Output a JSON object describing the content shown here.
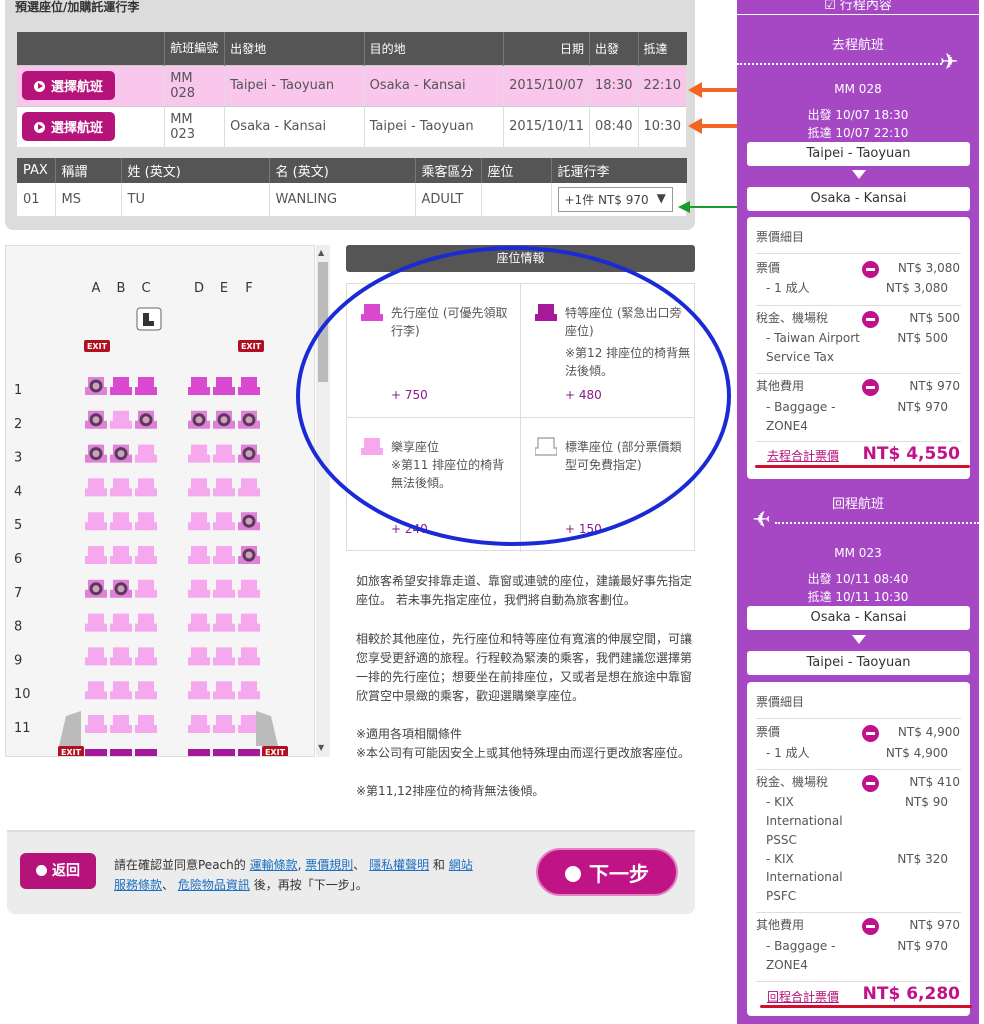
{
  "section_title": "預選座位/加購託運行李",
  "flights": {
    "headers": [
      "",
      "航班編號",
      "出發地",
      "目的地",
      "日期",
      "出發",
      "抵達"
    ],
    "select_label": "選擇航班",
    "rows": [
      {
        "flight": "MM 028",
        "from": "Taipei - Taoyuan",
        "to": "Osaka - Kansai",
        "date": "2015/10/07",
        "dep": "18:30",
        "arr": "22:10"
      },
      {
        "flight": "MM 023",
        "from": "Osaka - Kansai",
        "to": "Taipei - Taoyuan",
        "date": "2015/10/11",
        "dep": "08:40",
        "arr": "10:30"
      }
    ]
  },
  "pax": {
    "headers": [
      "PAX",
      "稱謂",
      "姓 (英文)",
      "名 (英文)",
      "乘客區分",
      "座位",
      "託運行李"
    ],
    "row": {
      "pax": "01",
      "title": "MS",
      "last": "TU",
      "first": "WANLING",
      "type": "ADULT",
      "seat": "",
      "bag": "+1件 NT$ 970"
    }
  },
  "seatmap": {
    "columns": [
      "A",
      "B",
      "C",
      "D",
      "E",
      "F"
    ],
    "rows": [
      "1",
      "2",
      "3",
      "4",
      "5",
      "6",
      "7",
      "8",
      "9",
      "10",
      "11"
    ],
    "exit": "EXIT"
  },
  "seat_info": {
    "title": "座位情報",
    "items": [
      {
        "name": "先行座位 (可優先領取行李)",
        "price": "+ 750"
      },
      {
        "name": "特等座位 (緊急出口旁座位)",
        "note": "※第12 排座位的椅背無法後傾。",
        "price": "+ 480"
      },
      {
        "name": "樂享座位",
        "note": "※第11 排座位的椅背無法後傾。",
        "price": "+ 240"
      },
      {
        "name": "標準座位 (部分票價類型可免費指定)",
        "price": "+ 150"
      }
    ],
    "para1": "如旅客希望安排靠走道、靠窗或連號的座位，建議最好事先指定座位。 若未事先指定座位，我們將自動為旅客劃位。",
    "para2": "相較於其他座位，先行座位和特等座位有寬濱的伸展空間，可讓您享受更舒適的旅程。行程較為緊湊的乘客，我們建議您選擇第一排的先行座位；想要坐在前排座位，又或者是想在旅途中靠窗欣賞空中景緻的乘客，歡迎選購樂享座位。",
    "notes": [
      "※適用各項相關條件",
      "※本公司有可能因安全上或其他特殊理由而逕行更改旅客座位。",
      "※第11,12排座位的椅背無法後傾。"
    ]
  },
  "footer": {
    "back": "返回",
    "next": "下一步",
    "text1": "請在確認並同意Peach的",
    "link1": "運輸條款",
    "link2": "票價規則",
    "link3": "隱私權聲明",
    "and": "和",
    "link4a": "網站",
    "link4b": "服務條款",
    "link5": "危險物品資訊",
    "text2": "後，再按「下一步」。"
  },
  "sidebar": {
    "title": "行程內容",
    "outbound": {
      "label": "去程航班",
      "flight": "MM 028",
      "dep": "出發 10/07 18:30",
      "arr": "抵達 10/07 22:10",
      "from": "Taipei - Taoyuan",
      "to": "Osaka - Kansai",
      "detail_title": "票價細目",
      "fare_label": "票價",
      "fare_val": "NT$ 3,080",
      "fare_sub": "- 1  成人",
      "fare_sub_val": "NT$ 3,080",
      "tax_label": "稅金、機場稅",
      "tax_val": "NT$ 500",
      "tax_sub1": "- Taiwan Airport",
      "tax_sub2": "Service Tax",
      "tax_sub_val": "NT$ 500",
      "other_label": "其他費用",
      "other_val": "NT$ 970",
      "other_sub1": "- Baggage -",
      "other_sub2": "ZONE4",
      "other_sub_val": "NT$ 970",
      "total_label": "去程合計票價",
      "total_val": "NT$ 4,550"
    },
    "inbound": {
      "label": "回程航班",
      "flight": "MM  023",
      "dep": "出發 10/11 08:40",
      "arr": "抵達 10/11 10:30",
      "from": "Osaka - Kansai",
      "to": "Taipei - Taoyuan",
      "detail_title": "票價細目",
      "fare_label": "票價",
      "fare_val": "NT$ 4,900",
      "fare_sub": "- 1  成人",
      "fare_sub_val": "NT$ 4,900",
      "tax_label": "稅金、機場稅",
      "tax_val": "NT$ 410",
      "tax_a1": "- KIX",
      "tax_a2": "International",
      "tax_a3": "PSSC",
      "tax_a_val": "NT$ 90",
      "tax_b1": "- KIX",
      "tax_b2": "International",
      "tax_b3": "PSFC",
      "tax_b_val": "NT$ 320",
      "other_label": "其他費用",
      "other_val": "NT$ 970",
      "other_sub1": "- Baggage -",
      "other_sub2": "ZONE4",
      "other_sub_val": "NT$ 970",
      "total_label": "回程合計票價",
      "total_val": "NT$ 6,280"
    }
  },
  "colors": {
    "brand": "#b5127a",
    "sidebar": "#a648c4",
    "annotation_blue": "#1a2ad4",
    "annotation_orange": "#f26522",
    "annotation_green": "#1a9a2a",
    "annotation_red": "#d0102a"
  }
}
